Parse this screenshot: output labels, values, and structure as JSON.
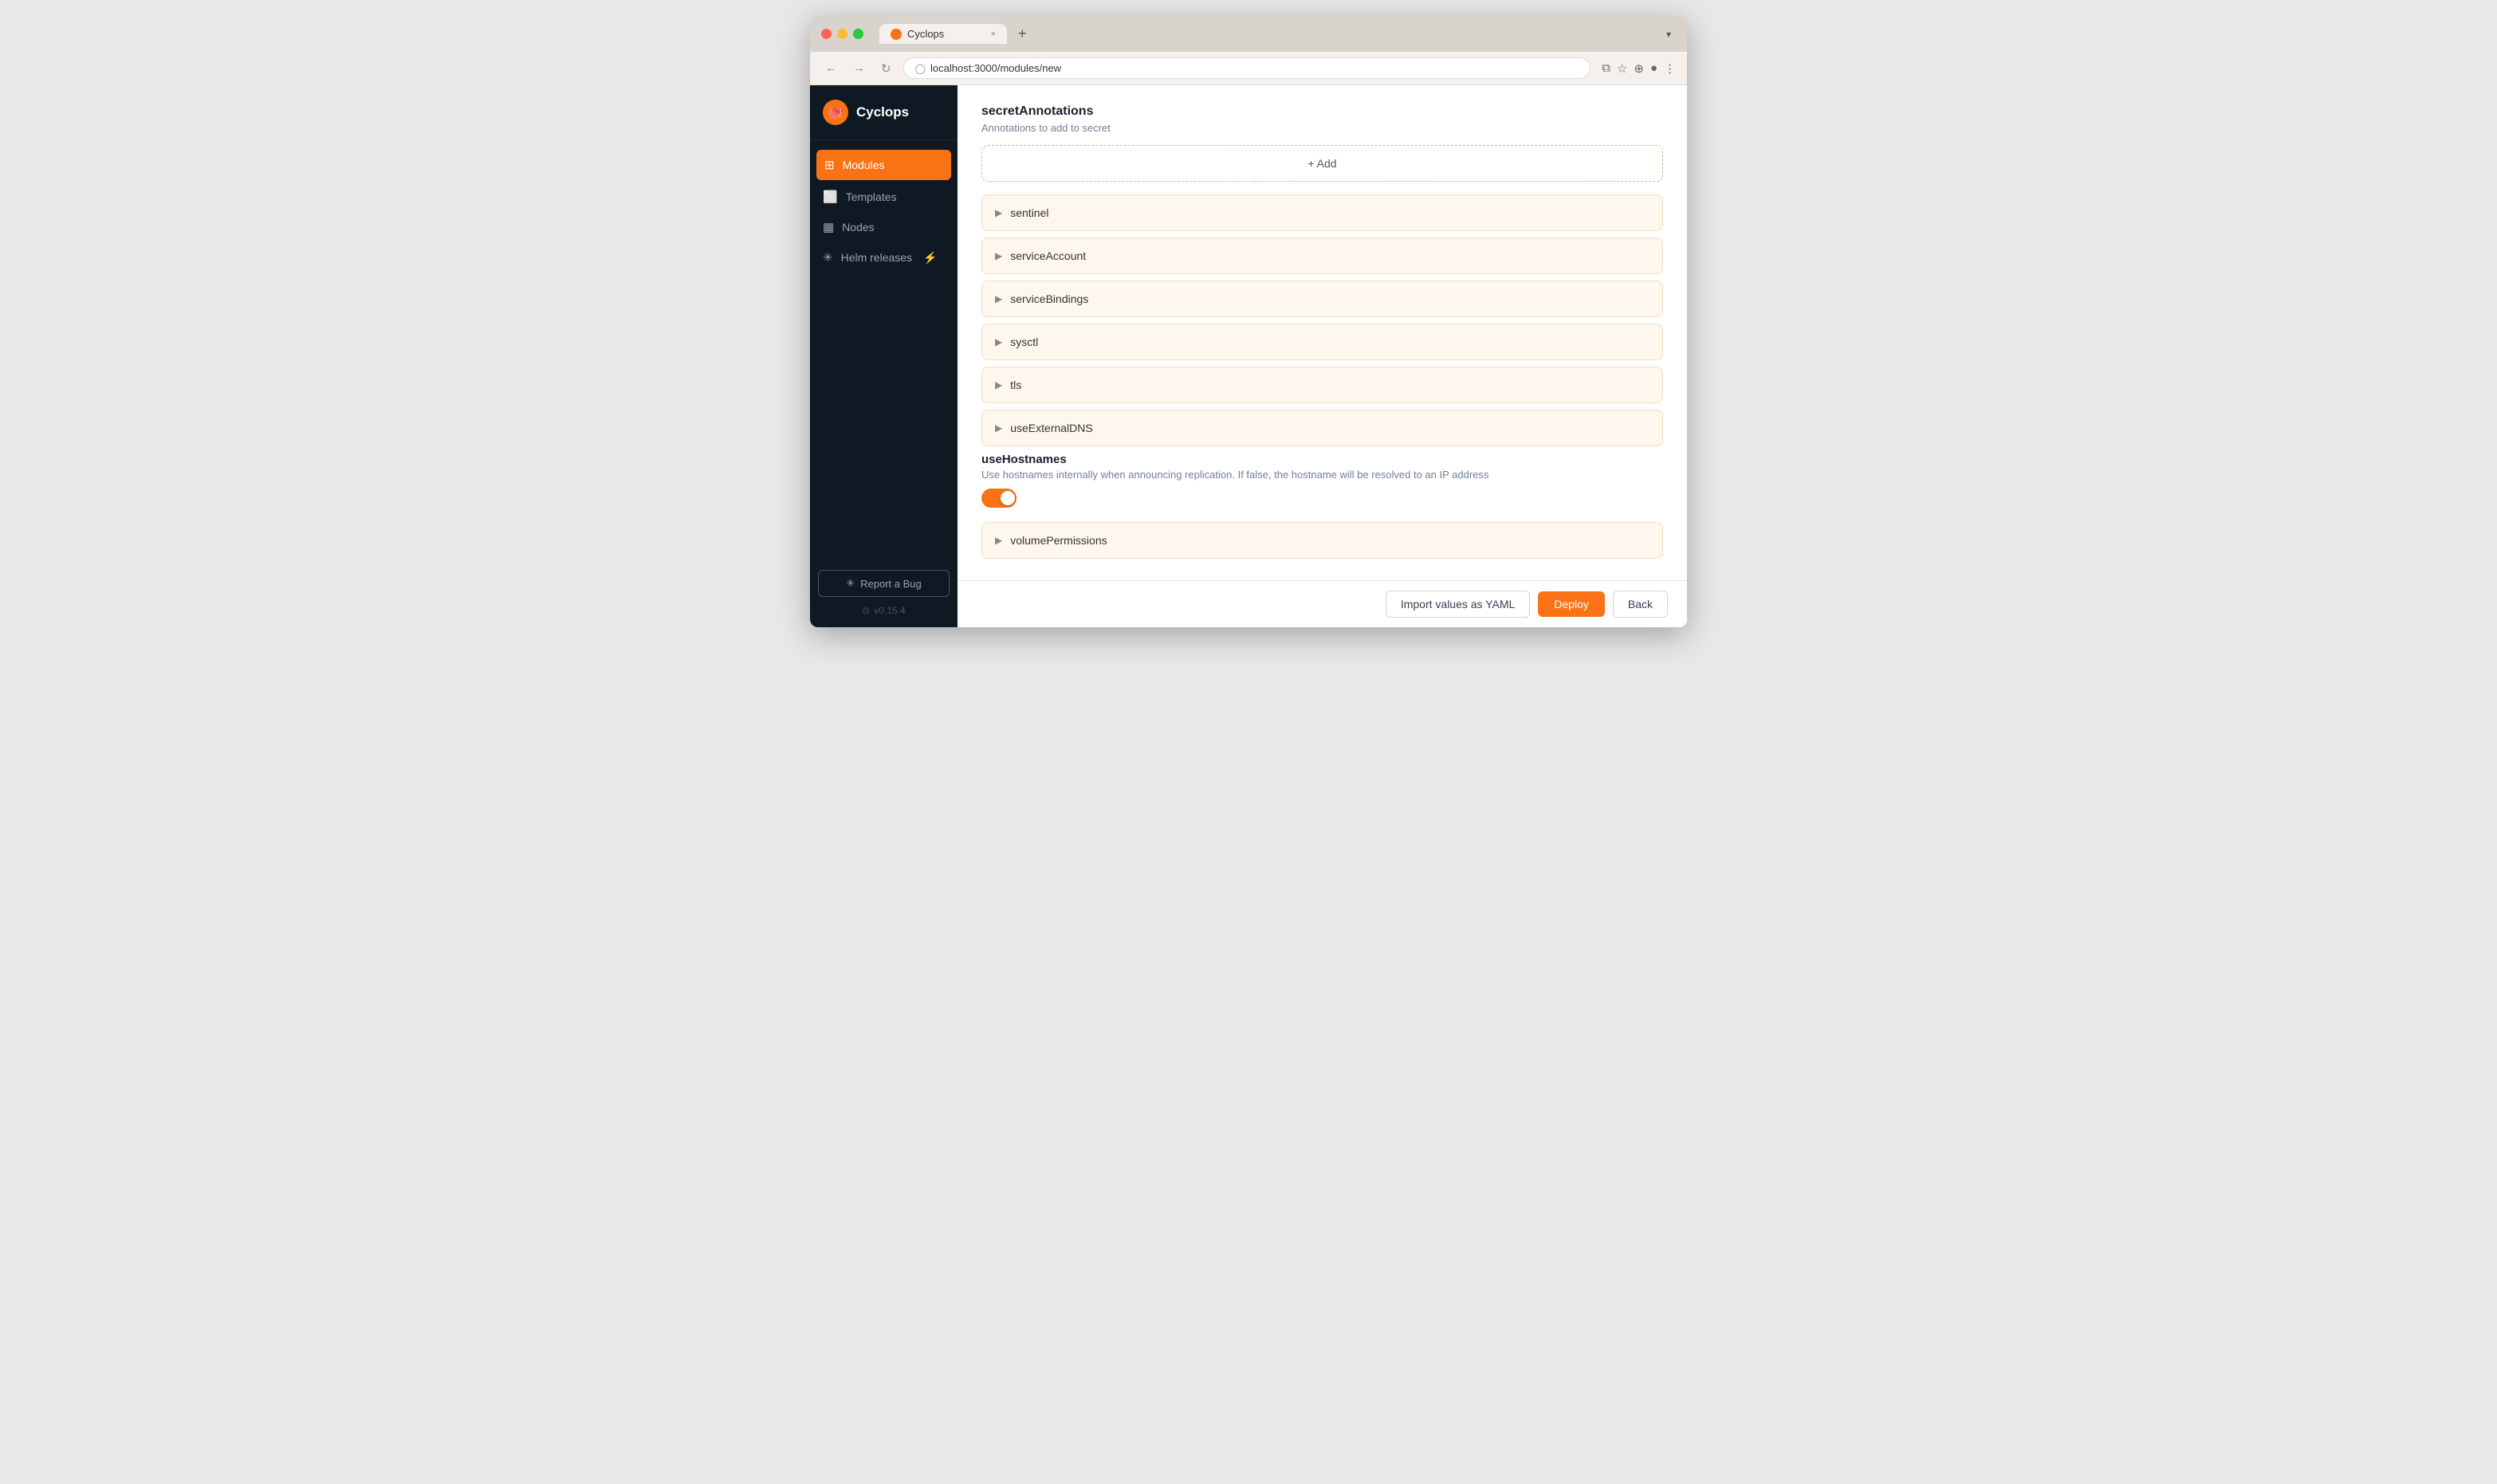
{
  "browser": {
    "tab_title": "Cyclops",
    "url": "localhost:3000/modules/new",
    "tab_close": "×",
    "tab_new": "+",
    "dropdown": "▾"
  },
  "sidebar": {
    "brand": "Cyclops",
    "items": [
      {
        "id": "modules",
        "label": "Modules",
        "icon": "⊞",
        "active": true
      },
      {
        "id": "templates",
        "label": "Templates",
        "icon": "⬜",
        "active": false
      },
      {
        "id": "nodes",
        "label": "Nodes",
        "icon": "▦",
        "active": false
      },
      {
        "id": "helm-releases",
        "label": "Helm releases",
        "icon": "✳",
        "active": false,
        "badge": "⚡"
      }
    ],
    "report_bug_label": "Report a Bug",
    "version": "v0.15.4"
  },
  "main": {
    "section_title": "secretAnnotations",
    "section_desc": "Annotations to add to secret",
    "add_label": "+ Add",
    "accordion_items": [
      {
        "id": "sentinel",
        "label": "sentinel"
      },
      {
        "id": "serviceAccount",
        "label": "serviceAccount"
      },
      {
        "id": "serviceBindings",
        "label": "serviceBindings"
      },
      {
        "id": "sysctl",
        "label": "sysctl"
      },
      {
        "id": "tls",
        "label": "tls"
      },
      {
        "id": "useExternalDNS",
        "label": "useExternalDNS"
      }
    ],
    "field_title": "useHostnames",
    "field_desc": "Use hostnames internally when announcing replication. If false, the hostname will be resolved to an IP address",
    "toggle_enabled": true,
    "accordion_items2": [
      {
        "id": "volumePermissions",
        "label": "volumePermissions"
      }
    ],
    "btn_import": "Import values as YAML",
    "btn_deploy": "Deploy",
    "btn_back": "Back"
  }
}
